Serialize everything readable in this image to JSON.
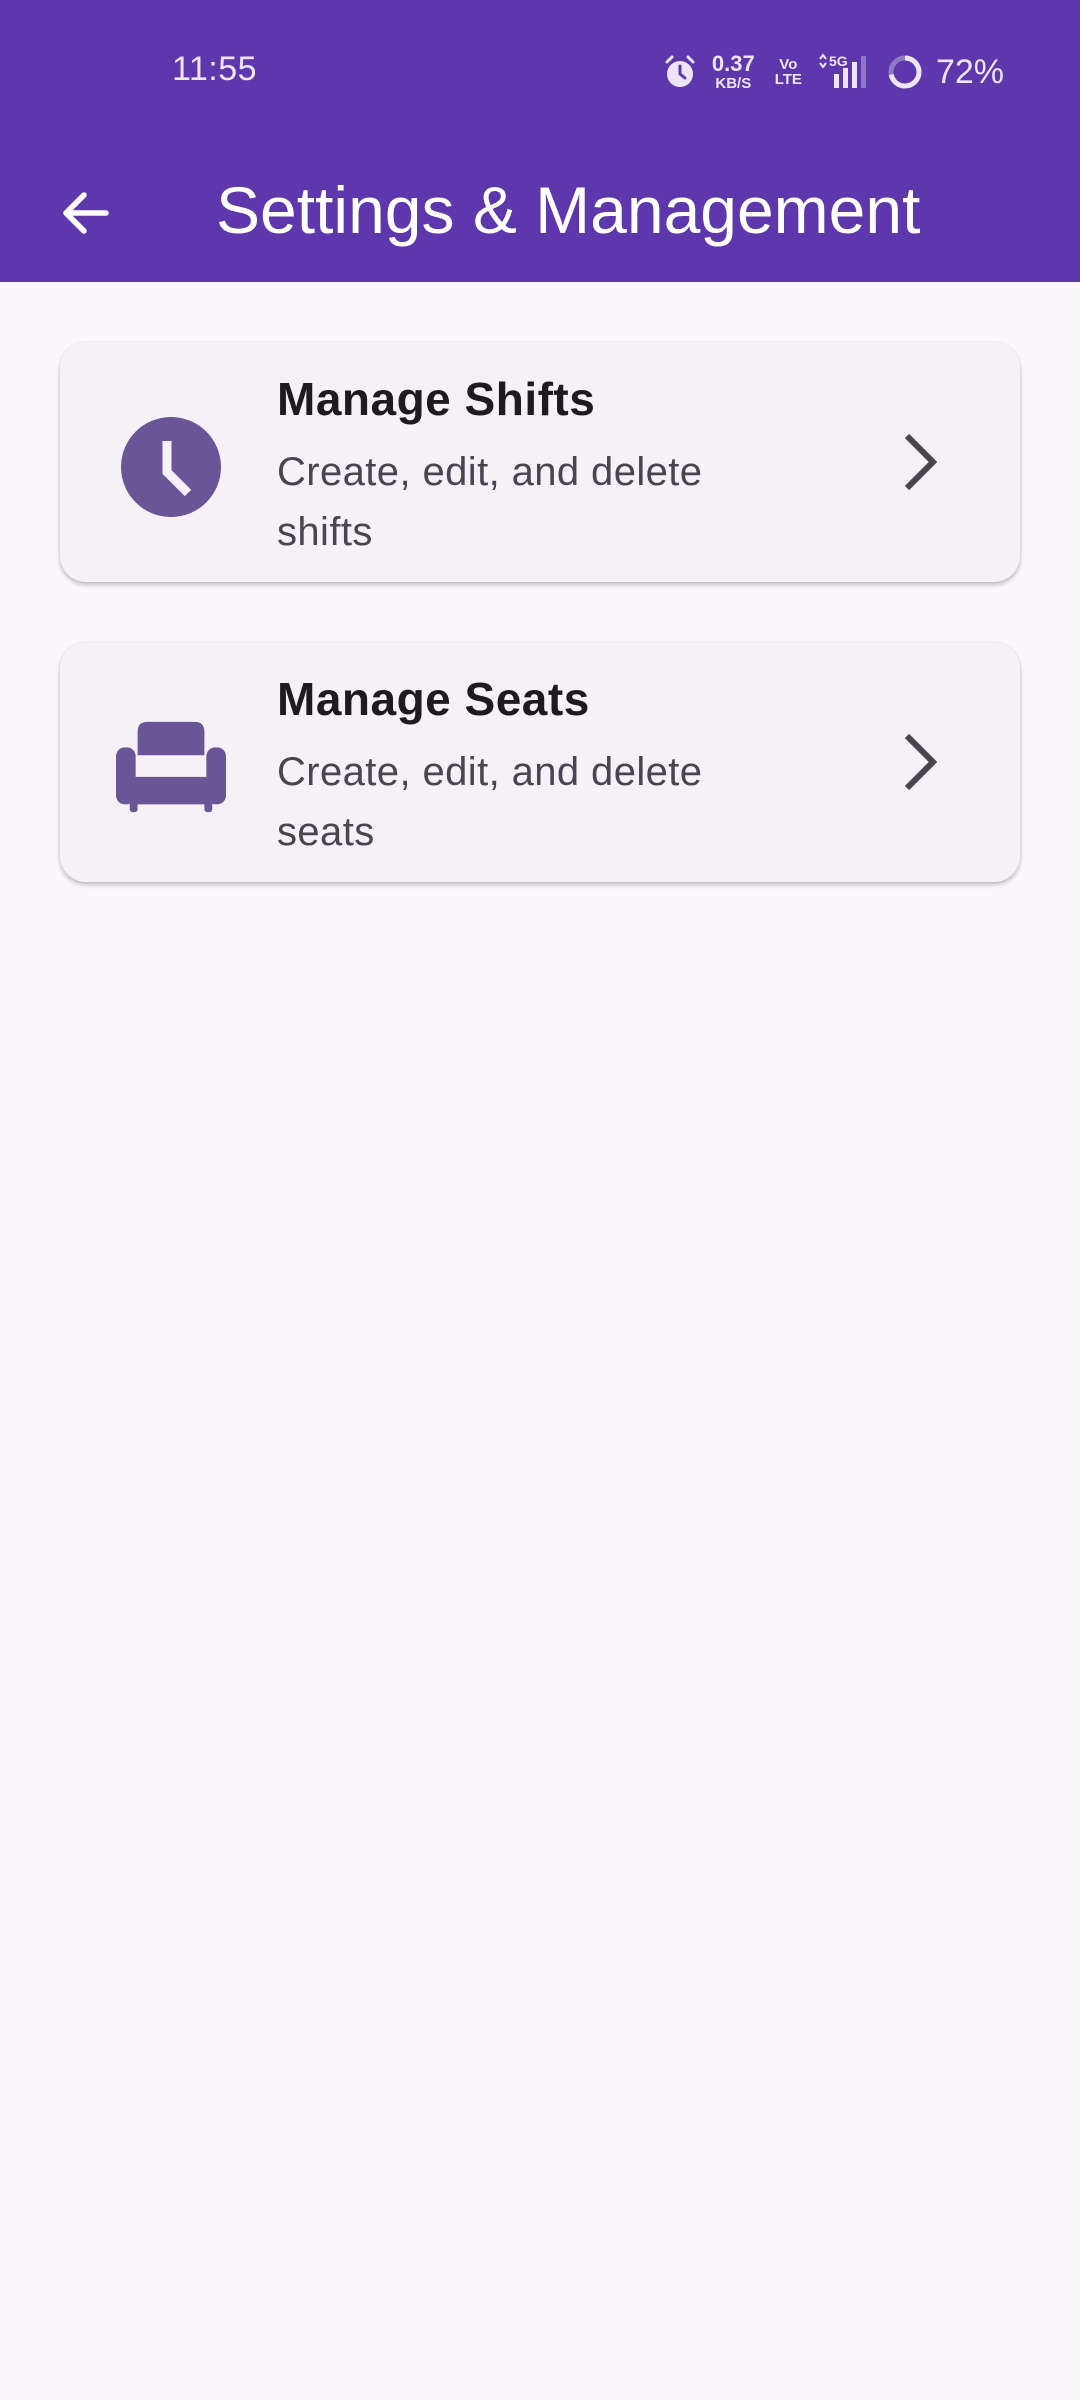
{
  "status_bar": {
    "time": "11:55",
    "net_speed_value": "0.37",
    "net_speed_unit": "KB/S",
    "volte_top": "Vo",
    "volte_bottom": "LTE",
    "network": "5G",
    "battery": "72%",
    "icons": [
      "alarm-icon",
      "signal-icon",
      "battery-ring-icon"
    ]
  },
  "app_bar": {
    "title": "Settings & Management",
    "back_icon": "arrow-back-icon",
    "color": "#5e37ad"
  },
  "cards": [
    {
      "title": "Manage Shifts",
      "subtitle": "Create, edit, and delete shifts",
      "icon": "clock-icon"
    },
    {
      "title": "Manage Seats",
      "subtitle": "Create, edit, and delete seats",
      "icon": "armchair-icon"
    }
  ],
  "colors": {
    "accent": "#5e37ad",
    "icon": "#6a5597",
    "background": "#fcf6fd",
    "card": "#f6f0f7"
  }
}
